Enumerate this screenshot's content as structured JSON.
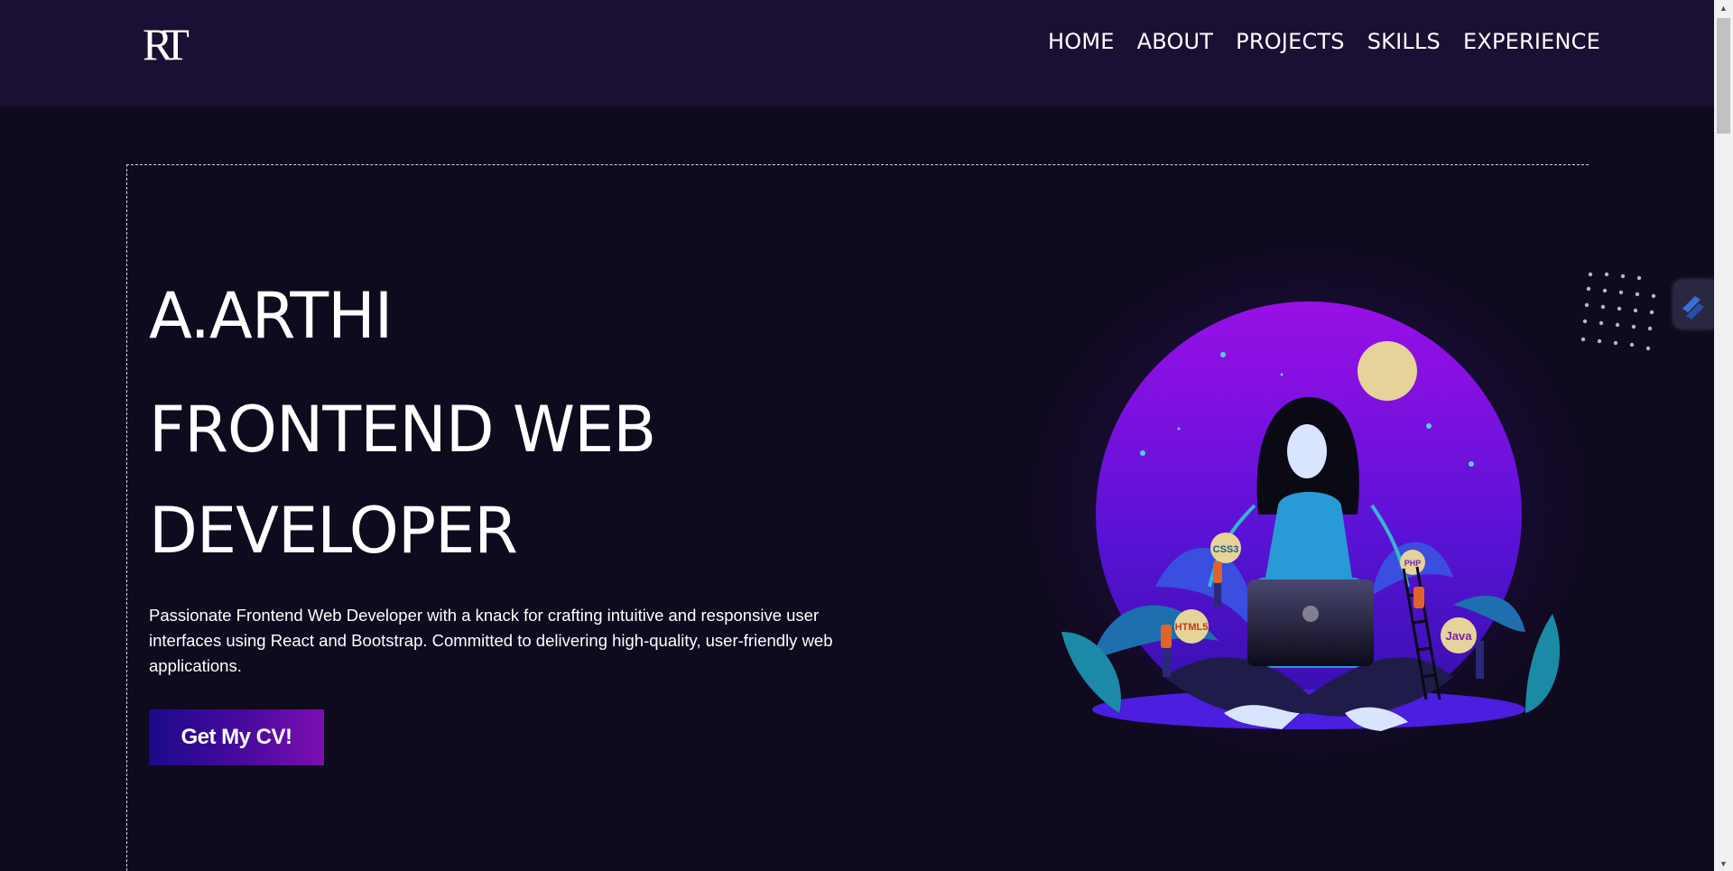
{
  "nav": {
    "logo_text": "RT",
    "links": [
      "HOME",
      "ABOUT",
      "PROJECTS",
      "SKILLS",
      "EXPERIENCE"
    ]
  },
  "hero": {
    "name": "A.ARTHI",
    "role": "FRONTEND WEB DEVELOPER",
    "description": "Passionate Frontend Web Developer with a knack for crafting intuitive and responsive user interfaces using React and Bootstrap. Committed to delivering high-quality, user-friendly web applications.",
    "cta_label": "Get My CV!"
  },
  "illustration": {
    "badges": [
      "CSS3",
      "PHP",
      "HTML5",
      "Java"
    ]
  },
  "colors": {
    "background": "#0f0a1e",
    "navbar": "#1b0f33",
    "accent_start": "#1a0a8a",
    "accent_end": "#7b0fb0",
    "orb": "#8a10e0"
  },
  "icons": {
    "side_widget": "layers-icon",
    "scroll_up": "scroll-up-arrow-icon",
    "scroll_down": "scroll-down-arrow-icon"
  }
}
